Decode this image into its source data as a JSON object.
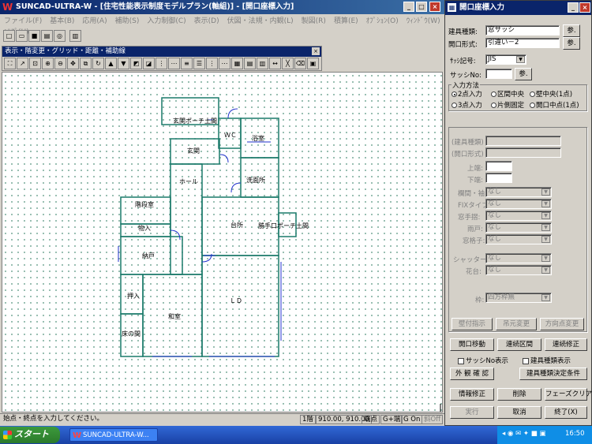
{
  "app": {
    "title": "SUNCAD-ULTRA-W - [住宅性能表示制度モデルプラン(軸組)] - [開口座標入力]",
    "menu": [
      "ファイル(F)",
      "基本(B)",
      "応用(A)",
      "補助(S)",
      "入力制御(C)",
      "表示(D)",
      "伏図・法規・内観(L)",
      "製図(R)",
      "積算(E)",
      "ｵﾌﾟｼｮﾝ(O)",
      "ｳｨﾝﾄﾞｳ(W)",
      "ﾍﾙﾌﾟ(H)"
    ],
    "floatbar_title": "表示・階変更・グリッド・距離・補助線"
  },
  "plan": {
    "rooms": [
      "玄関ポーチ土間",
      "ＷＣ",
      "浴室",
      "玄関",
      "ホール",
      "洗面所",
      "階段室",
      "物入",
      "台所",
      "勝手口ポーチ土間",
      "納戸",
      "押入",
      "ＬＤ",
      "和室",
      "床の間"
    ]
  },
  "status": {
    "message": "始点・終点を入力してください。",
    "floor": "1階",
    "grid": "910.00, 910.00",
    "snap": "端点",
    "gplus": "G+端",
    "gon": "G On",
    "oblique": "斜Off"
  },
  "taskbar": {
    "start": "スタート",
    "task": "SUNCAD-ULTRA-W...",
    "time": "16:50"
  },
  "panel": {
    "title": "開口座標入力",
    "fixture_type_label": "建具種類:",
    "fixture_type_value": "窓サッシ",
    "opening_type_label": "開口形式:",
    "opening_type_value": "引違い－2",
    "ref_button": "参.",
    "sash_code_label": "ｻｯｼ記号:",
    "sash_code_value": "JIS",
    "sash_no_label": "サッシNo:",
    "sash_no_value": "",
    "input_method_label": "入力方法",
    "radios": [
      {
        "label": "2点入力",
        "on": true
      },
      {
        "label": "区間中央",
        "on": false
      },
      {
        "label": "壁中央(1点)",
        "on": false
      },
      {
        "label": "3点入力",
        "on": false
      },
      {
        "label": "片側固定",
        "on": false
      },
      {
        "label": "開口中点(1点)",
        "on": false
      }
    ],
    "disabled_rows": [
      {
        "label": "(建具種類)",
        "value": ""
      },
      {
        "label": "(開口形式)",
        "value": ""
      },
      {
        "label": "上端:",
        "value": ""
      },
      {
        "label": "下端:",
        "value": ""
      }
    ],
    "combo_rows": [
      {
        "label": "欄間・袖:",
        "value": "なし"
      },
      {
        "label": "FIXタイプ:",
        "value": "なし"
      },
      {
        "label": "窓手摺:",
        "value": "なし"
      },
      {
        "label": "雨戸:",
        "value": "なし"
      },
      {
        "label": "窓格子:",
        "value": "なし"
      }
    ],
    "combo_rows2": [
      {
        "label": "シャッター:",
        "value": "なし"
      },
      {
        "label": "花台:",
        "value": "なし"
      }
    ],
    "frame_label": "枠:",
    "frame_value": "四方枠無",
    "btn_attach": "壁付指示",
    "btn_hinge": "吊元変更",
    "btn_dir": "方向点変更",
    "btn_move": "開口移動",
    "btn_continuous_section": "連続区間",
    "btn_continuous_fix": "連続修正",
    "chk_sashno": "サッシNo表示",
    "chk_fixture": "建具種類表示",
    "btn_appearance": "外 観 確 認",
    "btn_condition": "建具種類決定条件",
    "btn_info": "情報修正",
    "btn_delete": "削除",
    "btn_phase": "フェーズクリア",
    "btn_run": "実行",
    "btn_cancel": "取消",
    "btn_exit": "終了(X)"
  }
}
